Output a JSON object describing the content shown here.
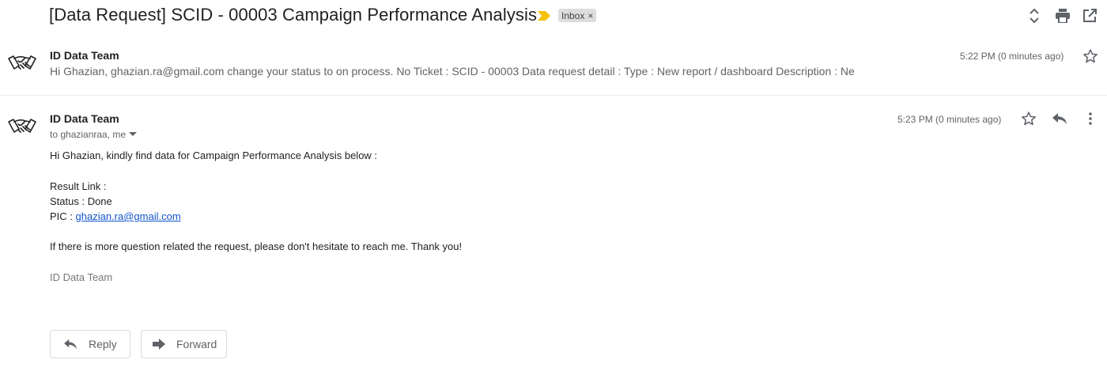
{
  "subject": {
    "title": "[Data Request] SCID - 00003 Campaign Performance Analysis",
    "label_chip": "Inbox",
    "label_remove": "×"
  },
  "messages": [
    {
      "sender": "ID Data Team",
      "snippet": "Hi Ghazian, ghazian.ra@gmail.com change your status to on process. No Ticket : SCID - 00003 Data request detail : Type : New report / dashboard Description : Ne",
      "time": "5:22 PM (0 minutes ago)"
    },
    {
      "sender": "ID Data Team",
      "recipients": "to ghazianraa, me",
      "time": "5:23 PM (0 minutes ago)",
      "body": {
        "greeting": "Hi Ghazian, kindly find data for Campaign Performance Analysis below :",
        "result_link": "Result Link :",
        "status": "Status : Done",
        "pic_label": "PIC : ",
        "pic_email": "ghazian.ra@gmail.com",
        "closing": "If there is more question related the request, please don't hesitate to reach me. Thank you!",
        "signature": "ID Data Team"
      }
    }
  ],
  "actions": {
    "reply": "Reply",
    "forward": "Forward"
  },
  "colors": {
    "importance": "#f4c20d",
    "link": "#1155cc",
    "icon": "#5f6368"
  }
}
